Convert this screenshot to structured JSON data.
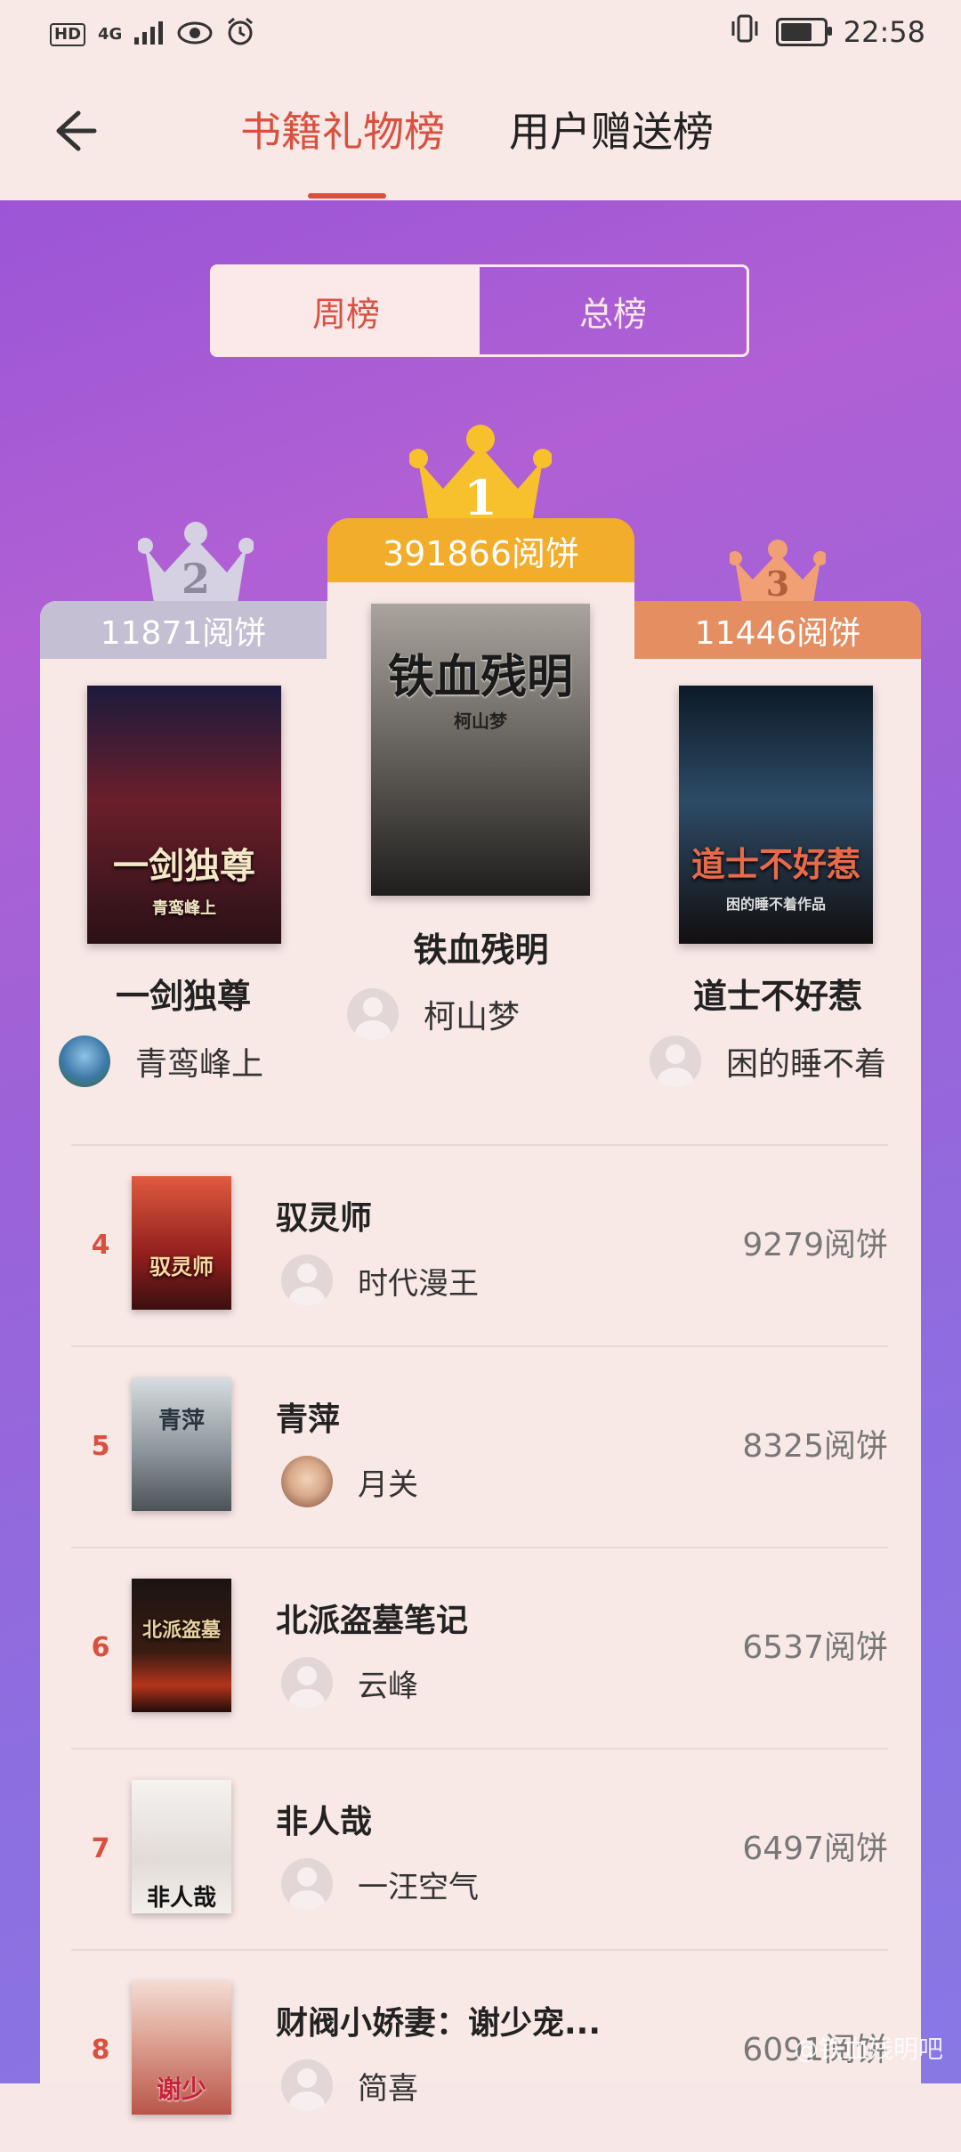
{
  "status_bar": {
    "hd": "HD",
    "signal": "4G",
    "time": "22:58",
    "battery_level": 0.85
  },
  "nav": {
    "tabs": [
      {
        "label": "书籍礼物榜",
        "active": true
      },
      {
        "label": "用户赠送榜",
        "active": false
      }
    ]
  },
  "period_switch": {
    "options": [
      {
        "label": "周榜",
        "selected": true
      },
      {
        "label": "总榜",
        "selected": false
      }
    ]
  },
  "unit": "阅饼",
  "podium": [
    {
      "rank": "1",
      "score": "391866阅饼",
      "title": "铁血残明",
      "user": "柯山梦",
      "cover_text": "铁血残明",
      "cover_author": "柯山梦",
      "cover_color": "#6e6b66"
    },
    {
      "rank": "2",
      "score": "11871阅饼",
      "title": "一剑独尊",
      "user": "青鸾峰上",
      "cover_text": "一剑独尊",
      "cover_author": "青鸾峰上",
      "cover_color": "#3d1d29"
    },
    {
      "rank": "3",
      "score": "11446阅饼",
      "title": "道士不好惹",
      "user": "困的睡不着",
      "cover_text": "道士不好惹",
      "cover_author": "困的睡不着作品",
      "cover_color": "#1c2a36"
    }
  ],
  "list": [
    {
      "rank": "4",
      "title": "驭灵师",
      "user": "时代漫王",
      "score": "9279阅饼",
      "cover_text": "驭灵师",
      "cover_color": "#a5362a"
    },
    {
      "rank": "5",
      "title": "青萍",
      "user": "月关",
      "score": "8325阅饼",
      "cover_text": "青萍",
      "cover_color": "#a7b1b8"
    },
    {
      "rank": "6",
      "title": "北派盗墓笔记",
      "user": "云峰",
      "score": "6537阅饼",
      "cover_text": "北派盗墓",
      "cover_color": "#2a1a14"
    },
    {
      "rank": "7",
      "title": "非人哉",
      "user": "一汪空气",
      "score": "6497阅饼",
      "cover_text": "非人哉",
      "cover_color": "#eeeae8"
    },
    {
      "rank": "8",
      "title": "财阀小娇妻：谢少宠...",
      "user": "简喜",
      "score": "6091阅饼",
      "cover_text": "谢少",
      "cover_color": "#e3b9b0"
    }
  ],
  "watermark": "@铁血残明吧",
  "colors": {
    "accent": "#d9503f",
    "gold": "#f2ad2b",
    "silver": "#c4bfd3",
    "bronze": "#e58e61",
    "background": "#f8e8e6"
  }
}
